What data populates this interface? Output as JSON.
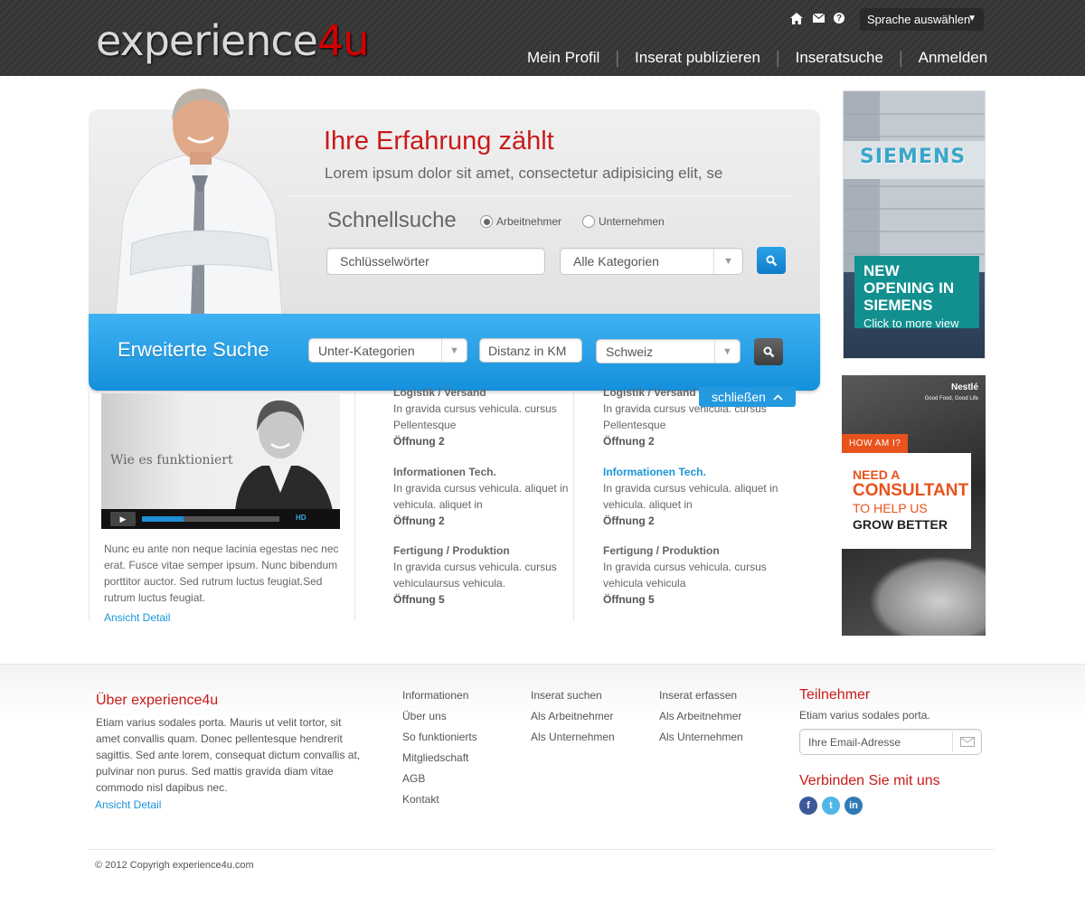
{
  "header": {
    "logo_part1": "experience",
    "logo_part2": "4u",
    "language_select": "Sprache auswählen",
    "nav": [
      "Mein Profil",
      "Inserat publizieren",
      "Inseratsuche",
      "Anmelden"
    ],
    "icons": [
      "home-icon",
      "mail-icon",
      "help-icon"
    ]
  },
  "hero": {
    "title": "Ihre Erfahrung zählt",
    "subtitle": "Lorem ipsum dolor sit amet, consectetur adipisicing elit, se",
    "quick_search_title": "Schnellsuche",
    "radio_options": [
      {
        "label": "Arbeitnehmer",
        "checked": true
      },
      {
        "label": "Unternehmen",
        "checked": false
      }
    ],
    "keywords_placeholder": "Schlüsselwörter",
    "category_select": "Alle Kategorien"
  },
  "advanced": {
    "title": "Erweiterte Suche",
    "subcategory_select": "Unter-Kategorien",
    "distance_placeholder": "Distanz in KM",
    "country_select": "Schweiz",
    "close_label": "schließen"
  },
  "intro": {
    "video_caption": "Wie es funktioniert",
    "video_badge": "HD",
    "video_progress": 0.3,
    "text": "Nunc eu ante non neque lacinia egestas nec nec erat. Fusce vitae semper ipsum. Nunc bibendum porttitor auctor. Sed rutrum luctus feugiat.Sed rutrum luctus feugiat.",
    "link": "Ansicht Detail"
  },
  "categories_left": [
    {
      "title": "Logistik / Versand",
      "text": "In gravida cursus vehicula. cursus Pellentesque",
      "openings": "Öffnung 2"
    },
    {
      "title": "Informationen Tech.",
      "text": "In gravida cursus vehicula. aliquet in vehicula. aliquet in",
      "openings": "Öffnung 2"
    },
    {
      "title": "Fertigung / Produktion",
      "text": "In gravida cursus vehicula. cursus vehiculaursus vehicula.",
      "openings": "Öffnung  5"
    }
  ],
  "categories_right": [
    {
      "title": "Logistik / Versand",
      "text": "In gravida cursus vehicula. cursus Pellentesque",
      "openings": "Öffnung 2"
    },
    {
      "title": "Informationen Tech.",
      "text": "In gravida cursus vehicula. aliquet in vehicula. aliquet in",
      "openings": "Öffnung 2"
    },
    {
      "title": "Fertigung / Produktion",
      "text": "In gravida cursus vehicula. cursus vehicula vehicula",
      "openings": "Öffnung  5"
    }
  ],
  "ads": {
    "ad1_sign": "SIEMENS",
    "ad1_headline": "NEW OPENING IN SIEMENS",
    "ad1_cta": "Click to more view",
    "ad2_brand": "Nestlé",
    "ad2_brand_tagline": "Good Food, Good Life",
    "ad2_tag": "HOW AM I?",
    "ad2_line1": "NEED A",
    "ad2_line2": "CONSULTANT",
    "ad2_line3": "TO HELP US",
    "ad2_line4": "GROW BETTER"
  },
  "footer": {
    "about_title": "Über experience4u",
    "about_text": "Etiam varius sodales porta. Mauris ut velit tortor, sit amet convallis quam. Donec pellentesque hendrerit sagittis. Sed ante lorem, consequat dictum convallis at, pulvinar non purus. Sed mattis gravida diam vitae commodo nisl dapibus nec.",
    "about_link": "Ansicht Detail",
    "links_col1": [
      "Informationen",
      "Über uns",
      "So funktionierts",
      "Mitgliedschaft",
      "AGB",
      "Kontakt"
    ],
    "links_col2": [
      "Inserat suchen",
      "Als Arbeitnehmer",
      "Als Unternehmen"
    ],
    "links_col3": [
      "Inserat erfassen",
      "Als Arbeitnehmer",
      "Als Unternehmen"
    ],
    "newsletter_title": "Teilnehmer",
    "newsletter_text": "Etiam varius sodales porta.",
    "email_placeholder": "Ihre Email-Adresse",
    "connect_title": "Verbinden Sie mit uns",
    "social": [
      {
        "icon": "facebook-icon",
        "glyph": "f",
        "color": "#3b5998"
      },
      {
        "icon": "twitter-icon",
        "glyph": "t",
        "color": "#4fb6e8"
      },
      {
        "icon": "linkedin-icon",
        "glyph": "in",
        "color": "#2e7bb5"
      }
    ],
    "copyright": "© 2012 Copyrigh experience4u.com"
  }
}
